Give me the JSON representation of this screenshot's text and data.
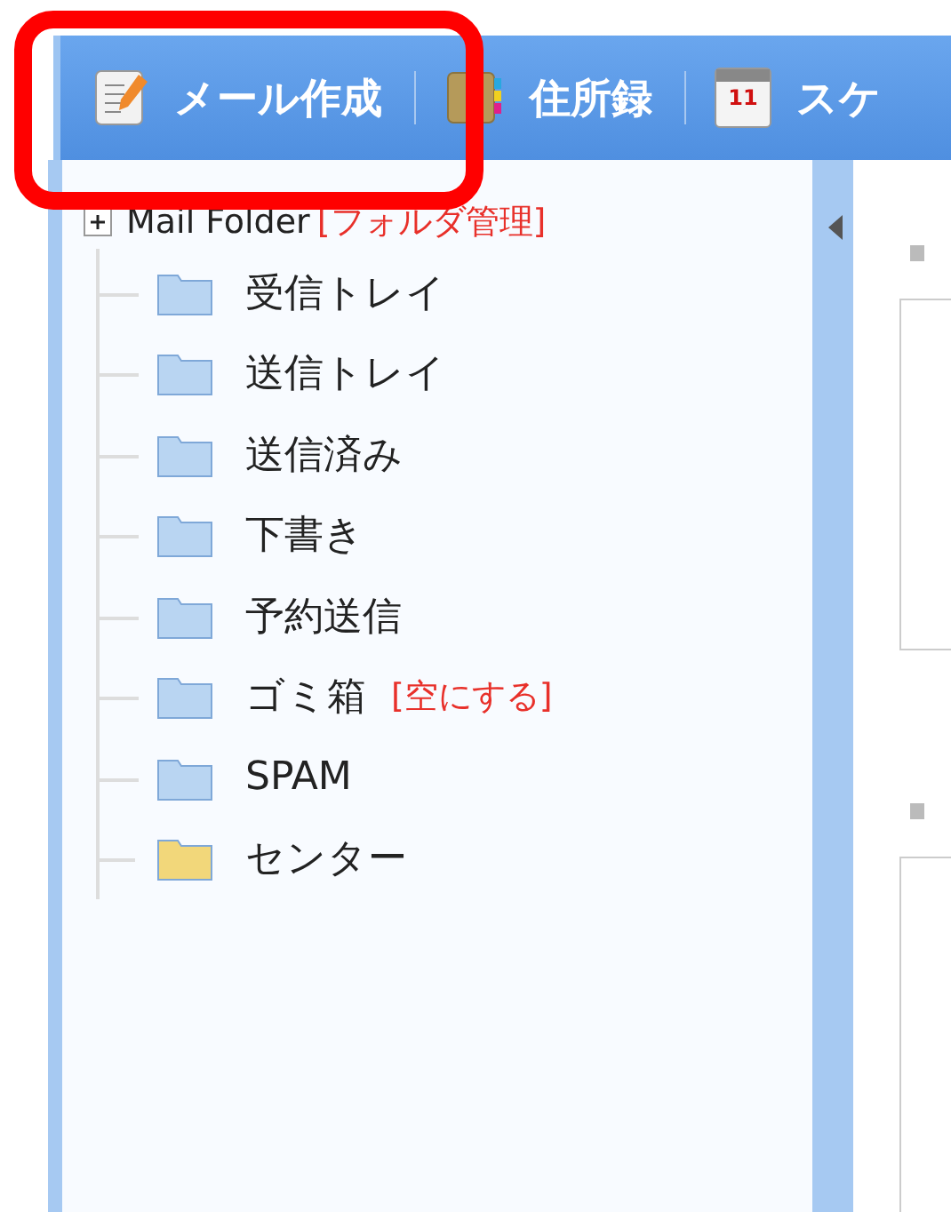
{
  "toolbar": {
    "items": [
      {
        "kind": "compose",
        "label": "メール作成",
        "highlighted": true
      },
      {
        "kind": "addressbook",
        "label": "住所録",
        "highlighted": false
      },
      {
        "kind": "calendar",
        "label": "スケ",
        "date": "11",
        "highlighted": false
      }
    ]
  },
  "folder_tree": {
    "root": {
      "label": "Mail Folder",
      "action": "[フォルダ管理]",
      "expanded": true
    },
    "children": [
      {
        "name": "受信トレイ",
        "color": "#b9d5f2"
      },
      {
        "name": "送信トレイ",
        "color": "#b9d5f2"
      },
      {
        "name": "送信済み",
        "color": "#b9d5f2"
      },
      {
        "name": "下書き",
        "color": "#b9d5f2"
      },
      {
        "name": "予約送信",
        "color": "#b9d5f2"
      },
      {
        "name": "ゴミ箱",
        "color": "#b9d5f2",
        "action": "[空にする]"
      },
      {
        "name": "SPAM",
        "color": "#b9d5f2"
      },
      {
        "name": "センター",
        "color": "#f2d77a"
      }
    ]
  }
}
